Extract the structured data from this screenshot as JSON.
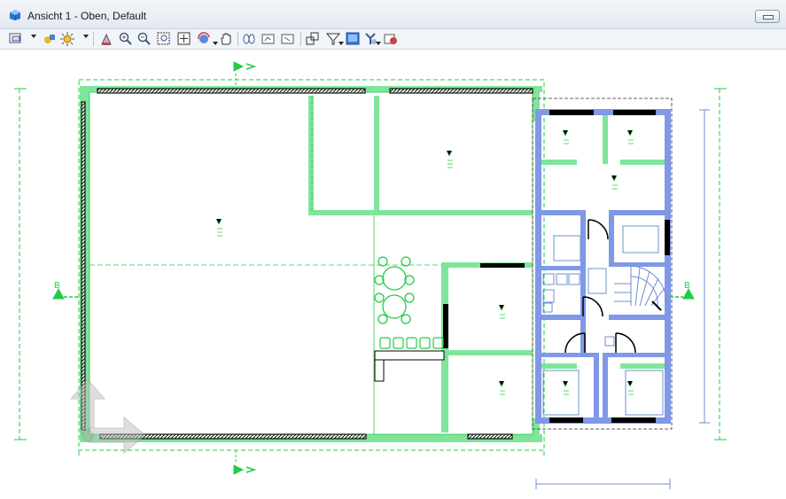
{
  "window": {
    "title": "Ansicht 1 - Oben, Default"
  },
  "toolbar": {
    "icons": [
      "view-attributes-icon",
      "dropdown-icon",
      "display-style-icon",
      "render-icon",
      "dropdown-icon",
      "camera-icon",
      "zoom-in-icon",
      "zoom-out-icon",
      "window-area-icon",
      "fit-view-icon",
      "rotate-view-icon",
      "pan-icon",
      "walk-icon",
      "copy-view-icon",
      "previous-view-icon",
      "clip-volume-icon",
      "filter-icon",
      "view-display-icon",
      "settings-icon",
      "toggle-view-icon"
    ]
  },
  "drawing": {
    "section_marker_label": "B",
    "colors": {
      "dimension": "#22cc44",
      "wall": "#7fe59a",
      "hatched_wall": "#111111",
      "annex_wall": "#7f98e8",
      "annex_dimension": "#6f8fcf"
    }
  }
}
